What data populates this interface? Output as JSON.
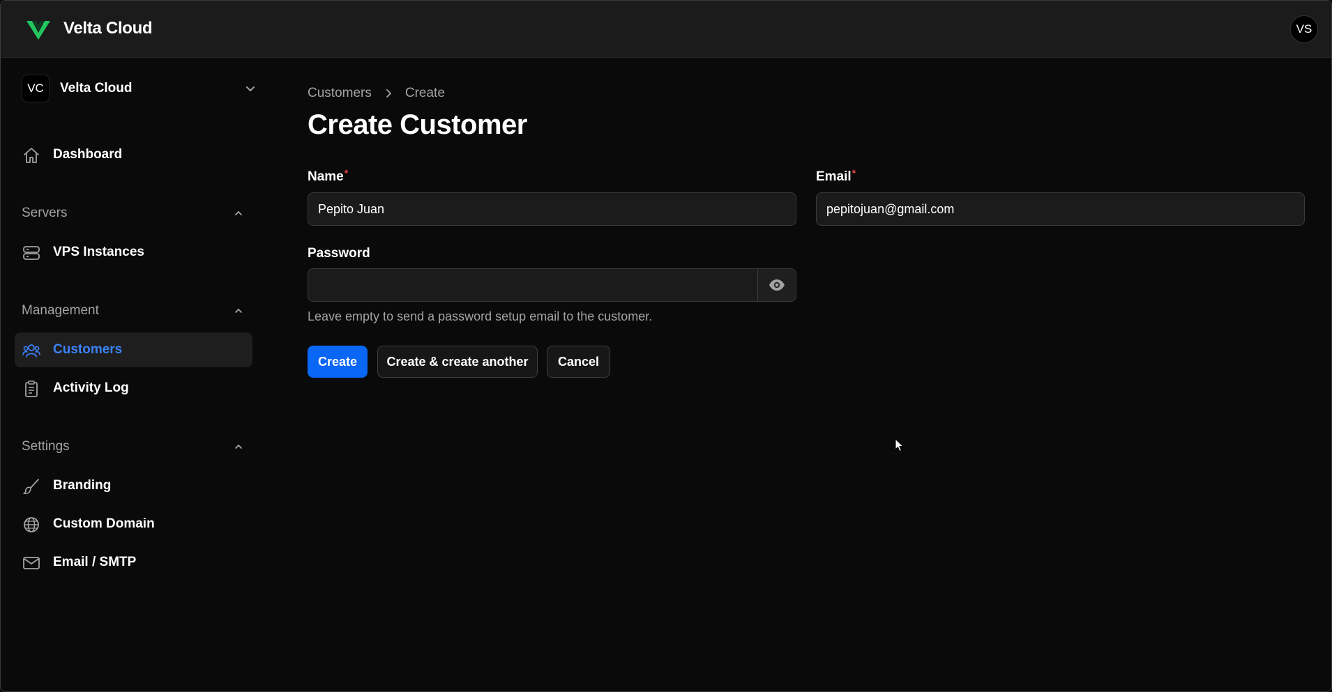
{
  "app": {
    "brand_name": "Velta Cloud",
    "user_initials": "VS",
    "accent_color": "#0a66f5",
    "logo_color": "#22c55e"
  },
  "sidebar": {
    "tenant": {
      "initials": "VC",
      "name": "Velta Cloud"
    },
    "dashboard": {
      "label": "Dashboard",
      "icon": "home-icon"
    },
    "groups": {
      "servers": {
        "label": "Servers",
        "items": [
          {
            "label": "VPS Instances",
            "icon": "server-icon"
          }
        ]
      },
      "management": {
        "label": "Management",
        "items": [
          {
            "label": "Customers",
            "icon": "users-icon",
            "active": true
          },
          {
            "label": "Activity Log",
            "icon": "clipboard-icon"
          }
        ]
      },
      "settings": {
        "label": "Settings",
        "items": [
          {
            "label": "Branding",
            "icon": "paintbrush-icon"
          },
          {
            "label": "Custom Domain",
            "icon": "globe-icon"
          },
          {
            "label": "Email / SMTP",
            "icon": "mail-icon"
          }
        ]
      }
    }
  },
  "main": {
    "breadcrumb": {
      "parent": "Customers",
      "current": "Create"
    },
    "title": "Create Customer",
    "form": {
      "name": {
        "label": "Name",
        "required_mark": "*",
        "value": "Pepito Juan"
      },
      "email": {
        "label": "Email",
        "required_mark": "*",
        "value": "pepitojuan@gmail.com"
      },
      "password": {
        "label": "Password",
        "value": "",
        "help": "Leave empty to send a password setup email to the customer."
      }
    },
    "actions": {
      "create": "Create",
      "create_another": "Create & create another",
      "cancel": "Cancel"
    }
  }
}
